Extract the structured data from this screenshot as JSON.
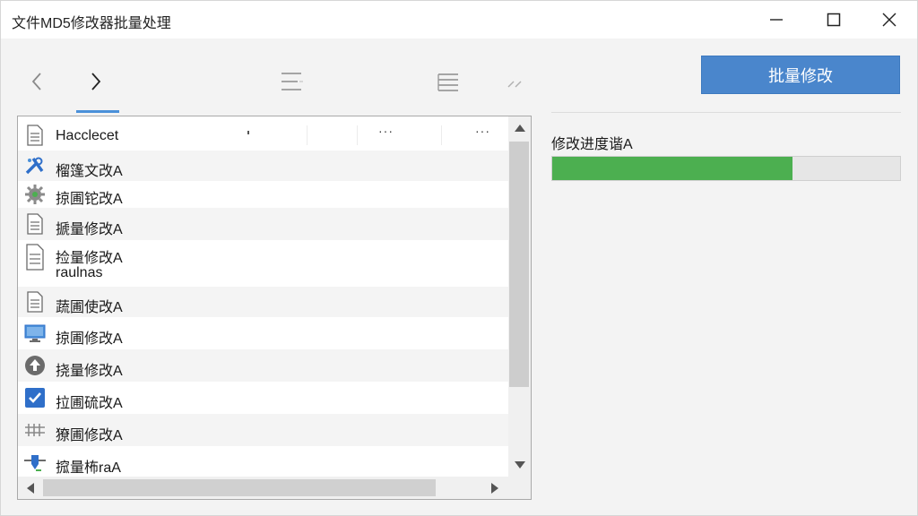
{
  "window": {
    "title": "文件MD5修改器批量处理"
  },
  "toolbar": {
    "batch_button_label": "批量修改",
    "icons": [
      "chevron-left-icon",
      "chevron-right-icon",
      "list-view-icon",
      "detail-view-icon",
      "edit-icon"
    ]
  },
  "file_list": {
    "header": {
      "name": "Hacclecet",
      "col2_dots": "···",
      "col3_dots": "···"
    },
    "items": [
      {
        "icon": "document-icon",
        "label": "Hacclecet"
      },
      {
        "icon": "tools-icon",
        "label": "榴篷文改A"
      },
      {
        "icon": "gear-icon",
        "label": "掠圃铊改A"
      },
      {
        "icon": "document-icon",
        "label": "搋量修改A"
      },
      {
        "icon": "document-icon",
        "label": "捡量修改A",
        "sub": "raulnas"
      },
      {
        "icon": "document-icon",
        "label": "蔬圃使改A"
      },
      {
        "icon": "monitor-icon",
        "label": "掠圃修改A"
      },
      {
        "icon": "upload-icon",
        "label": "挠量修改A"
      },
      {
        "icon": "checkbox-icon",
        "label": "拉圃硫改A"
      },
      {
        "icon": "grid-icon",
        "label": "獠圃修改A"
      },
      {
        "icon": "tag-icon",
        "label": "搲量柨raA"
      }
    ]
  },
  "progress": {
    "label": "修改进度谐A",
    "value": 0.69,
    "color": "#4caf50"
  },
  "colors": {
    "accent": "#4a86cc",
    "progress": "#4caf50"
  }
}
